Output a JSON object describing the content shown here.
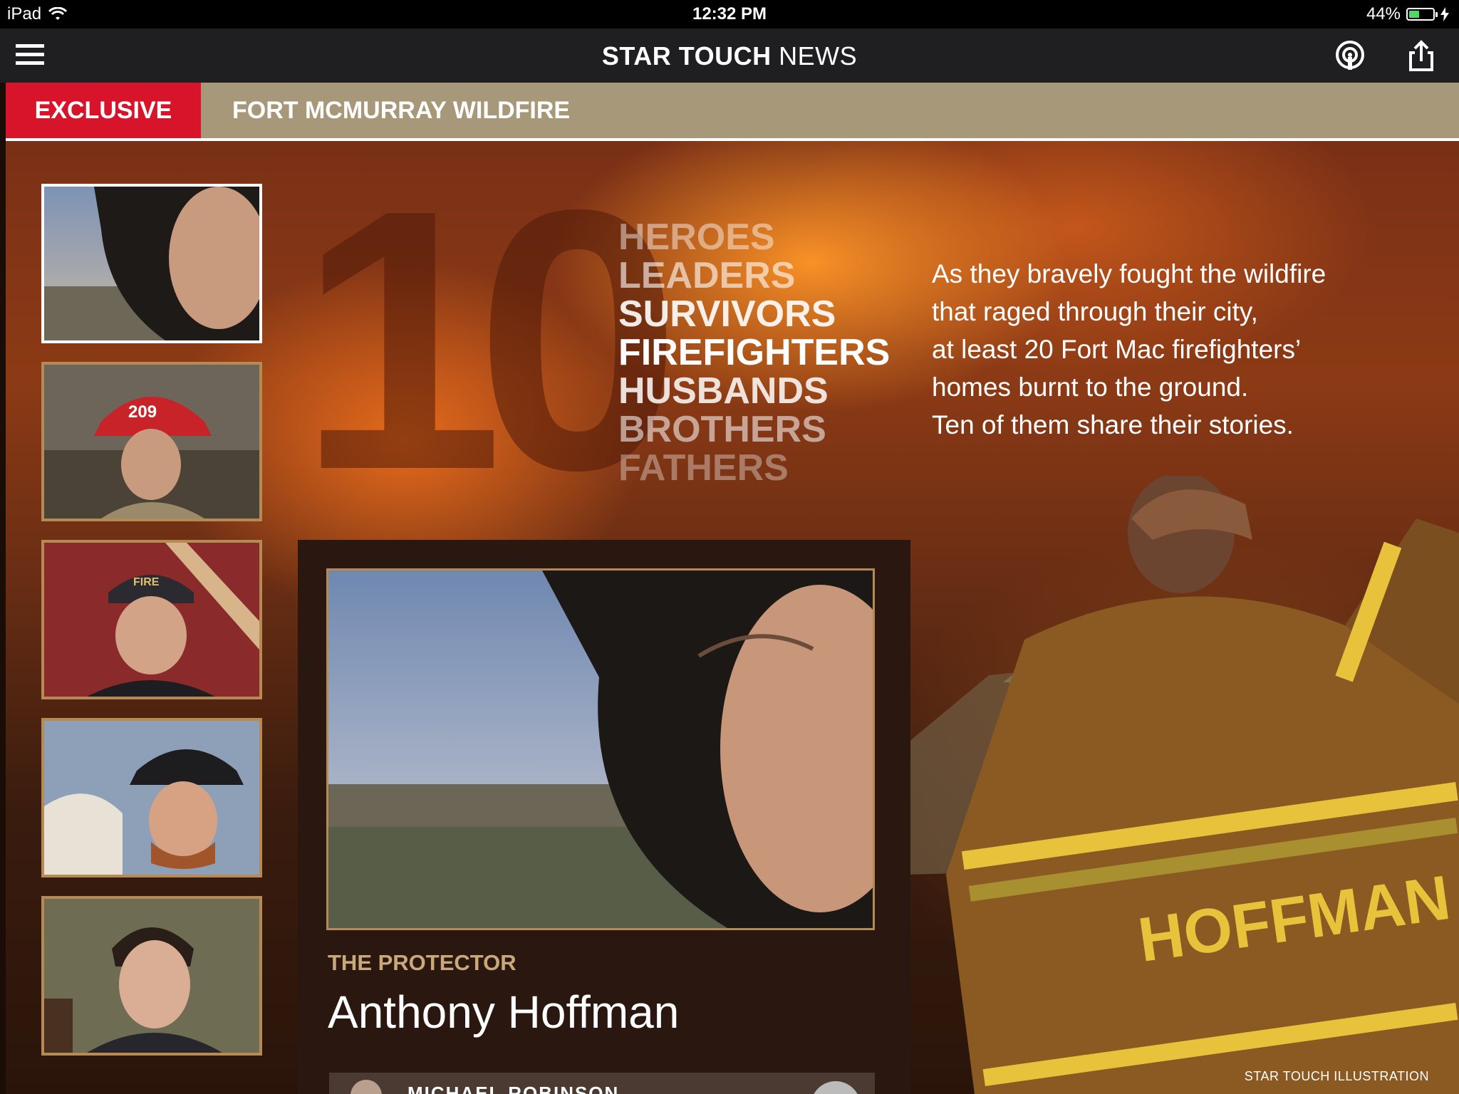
{
  "status_bar": {
    "device": "iPad",
    "time": "12:32 PM",
    "battery": "44%",
    "battery_level": 0.44
  },
  "nav": {
    "brand_strong": "STAR TOUCH",
    "brand_light": "NEWS"
  },
  "section": {
    "tab_label": "EXCLUSIVE",
    "topic": "FORT MCMURRAY WILDFIRE"
  },
  "hero": {
    "big_number": "10",
    "words": [
      "HEROES",
      "LEADERS",
      "SURVIVORS",
      "FIREFIGHTERS",
      "HUSBANDS",
      "BROTHERS",
      "FATHERS"
    ],
    "intro_lines": [
      "As they bravely fought the wildfire",
      "that raged through their city,",
      "at least 20 Fort Mac firefighters’",
      "homes burnt to the ground.",
      "Ten of them share their stories."
    ],
    "jacket_name": "HOFFMAN",
    "helmet_number": "209",
    "cap_text": "FIRE",
    "credit": "STAR TOUCH ILLUSTRATION"
  },
  "feature": {
    "kicker": "THE PROTECTOR",
    "name": "Anthony Hoffman",
    "author": "MICHAEL ROBINSON"
  },
  "colors": {
    "exclusive_red": "#d7142a",
    "section_tan": "#a8987a",
    "accent_gold": "#c9a87a"
  }
}
